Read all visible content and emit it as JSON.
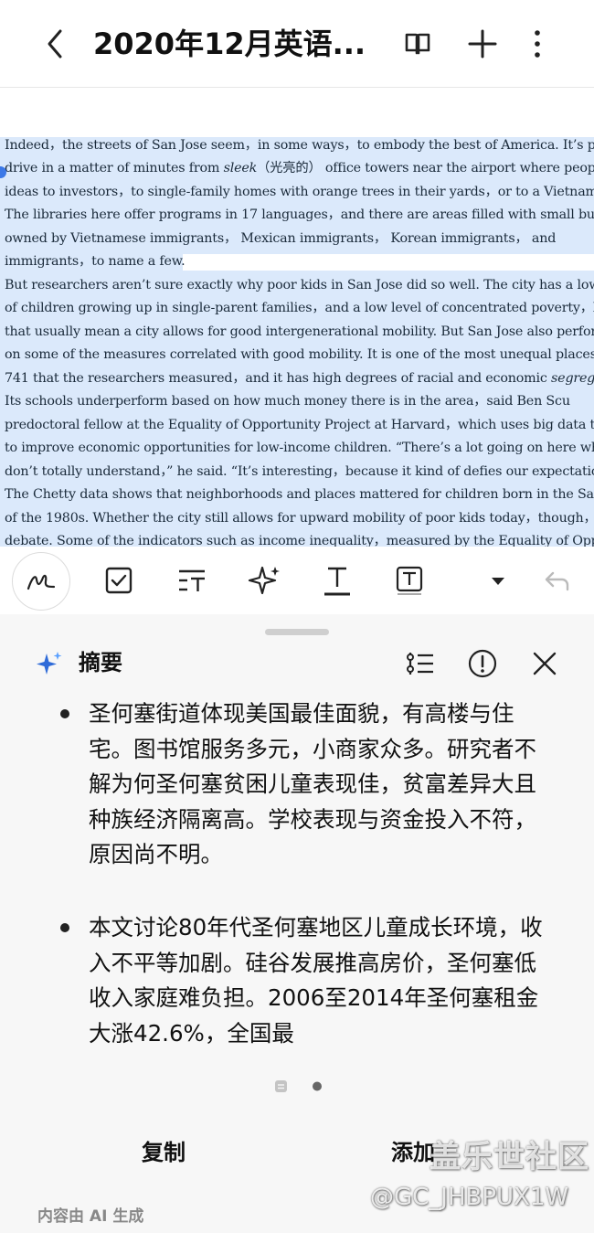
{
  "header": {
    "title": "2020年12月英语..."
  },
  "document": {
    "lines": [
      "Indeed，the streets of San Jose seem，in some ways，to embody the best of America. It’s po",
      "drive in a matter of minutes from ",
      "ideas to investors，to single-family homes with orange trees in their yards，or to a Vietname",
      "The libraries here offer programs in 17 languages，and there are areas filled with small bu",
      "owned by  Vietnamese  immigrants，  Mexican  immigrants，  Korean  immigrants，  and",
      "immigrants，to name a few.",
      "But researchers aren’t sure exactly why poor kids in San Jose did so well.  The city has a low pro",
      "of children growing up in single-parent families，and a low level of concentrated poverty，both",
      "that usually mean a city allows for good intergenerational mobility. But San Jose also perform",
      "on some of the measures correlated with good mobility.  It is one of the most unequal places ou",
      "741 that the researchers measured，and it has high degrees of racial and economic ",
      "Its schools underperform based on how much money there is in the area，said Ben Scu",
      "predoctoral fellow at the Equality of Opportunity Project at Harvard，which uses big data to st",
      "to improve economic opportunities for low-income children. “There’s a lot going on here wh",
      "don’t totally understand，” he said. “It’s interesting，because it kind of defies our expectations",
      "The Chetty data shows that neighborhoods and places mattered for children born in the San J",
      "of the 1980s. Whether the city still allows for upward mobility of poor kids today，though，i",
      "debate. Some of the indicators such as income inequality，measured by the Equality of Opp"
    ],
    "line2_italic": "sleek",
    "line2_gloss": "（光亮的）",
    "line2_rest": " office towers near the airport where peop",
    "line11_italic": "segregation"
  },
  "summary": {
    "title": "摘要",
    "bullets": [
      "圣何塞街道体现美国最佳面貌，有高楼与住宅。图书馆服务多元，小商家众多。研究者不解为何圣何塞贫困儿童表现佳，贫富差异大且种族经济隔离高。学校表现与资金投入不符，原因尚不明。",
      "本文讨论80年代圣何塞地区儿童成长环境，收入不平等加剧。硅谷发展推高房价，圣何塞低收入家庭难负担。2006至2014年圣何塞租金大涨42.6%，全国最"
    ],
    "copy_label": "复制",
    "add_label": "添加",
    "ai_note": "内容由 AI 生成"
  },
  "watermark": {
    "line1": "盖乐世社区",
    "line2": "@GC_JHBPUX1W"
  },
  "colors": {
    "selection": "#dbe9fb",
    "accent": "#3b78e7",
    "sparkle": "#2f6bd8"
  }
}
